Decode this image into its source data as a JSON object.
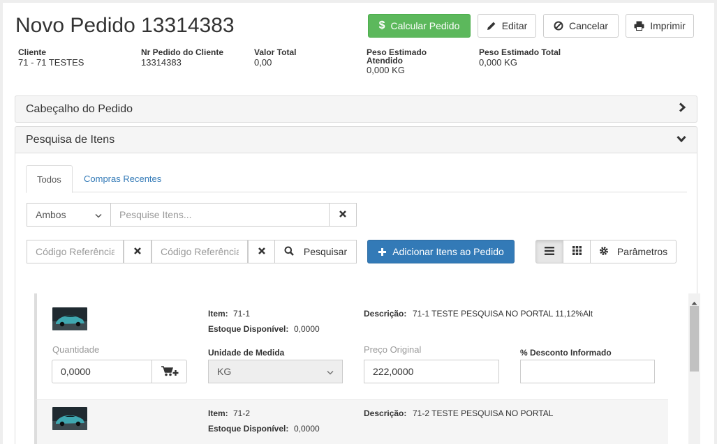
{
  "header": {
    "title": "Novo Pedido 13314383",
    "buttons": {
      "calculate": "Calcular Pedido",
      "edit": "Editar",
      "cancel": "Cancelar",
      "print": "Imprimir"
    }
  },
  "summary": {
    "client_label": "Cliente",
    "client_value": "71 - 71 TESTES",
    "order_no_label": "Nr Pedido do Cliente",
    "order_no_value": "13314383",
    "total_label": "Valor Total",
    "total_value": "0,00",
    "weight_served_label_1": "Peso Estimado",
    "weight_served_label_2": "Atendido",
    "weight_served_value": "0,000 KG",
    "weight_total_label": "Peso Estimado Total",
    "weight_total_value": "0,000 KG"
  },
  "panels": {
    "header_panel": "Cabeçalho do Pedido",
    "search_panel": "Pesquisa de Itens"
  },
  "tabs": {
    "all": "Todos",
    "recent": "Compras Recentes"
  },
  "search": {
    "scope_selected": "Ambos",
    "items_placeholder": "Pesquise Itens...",
    "ref_code_placeholder_1": "Código Referência",
    "ref_code_placeholder_2": "Código Referência",
    "search_button": "Pesquisar",
    "add_items_button": "Adicionar Itens ao Pedido",
    "params_button": "Parâmetros"
  },
  "items": [
    {
      "item_label": "Item:",
      "item_value": "71-1",
      "stock_label": "Estoque Disponível:",
      "stock_value": "0,0000",
      "desc_label": "Descrição:",
      "desc_value": "71-1 TESTE PESQUISA NO PORTAL 11,12%Alt",
      "qty_label": "Quantidade",
      "qty_value": "0,0000",
      "unit_label": "Unidade de Medida",
      "unit_value": "KG",
      "price_label": "Preço Original",
      "price_value": "222,0000",
      "discount_label": "% Desconto Informado",
      "discount_value": ""
    },
    {
      "item_label": "Item:",
      "item_value": "71-2",
      "stock_label": "Estoque Disponível:",
      "stock_value": "0,0000",
      "desc_label": "Descrição:",
      "desc_value": "71-2 TESTE PESQUISA NO PORTAL"
    }
  ],
  "colors": {
    "success": "#5cb85c",
    "primary": "#337ab7",
    "link": "#337ab7"
  }
}
